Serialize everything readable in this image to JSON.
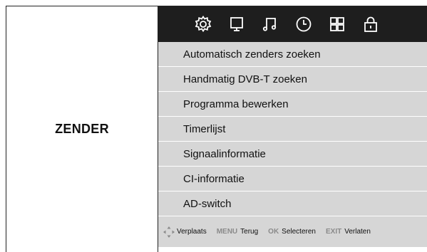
{
  "section": {
    "title": "ZENDER"
  },
  "icons": [
    "settings-gear-icon",
    "picture-monitor-icon",
    "sound-music-icon",
    "time-clock-icon",
    "apps-grid-icon",
    "lock-icon"
  ],
  "menu": {
    "items": [
      {
        "label": "Automatisch zenders zoeken"
      },
      {
        "label": "Handmatig DVB-T zoeken"
      },
      {
        "label": "Programma bewerken"
      },
      {
        "label": "Timerlijst"
      },
      {
        "label": "Signaalinformatie"
      },
      {
        "label": "CI-informatie"
      },
      {
        "label": "AD-switch"
      }
    ]
  },
  "footer": {
    "move_label": "Verplaats",
    "menu_key": "MENU",
    "menu_label": "Terug",
    "ok_key": "OK",
    "ok_label": "Selecteren",
    "exit_key": "EXIT",
    "exit_label": "Verlaten"
  },
  "colors": {
    "icon_bar_bg": "#1e1e1e",
    "menu_bg": "#d6d6d6",
    "key_gray": "#8a8a8a"
  }
}
